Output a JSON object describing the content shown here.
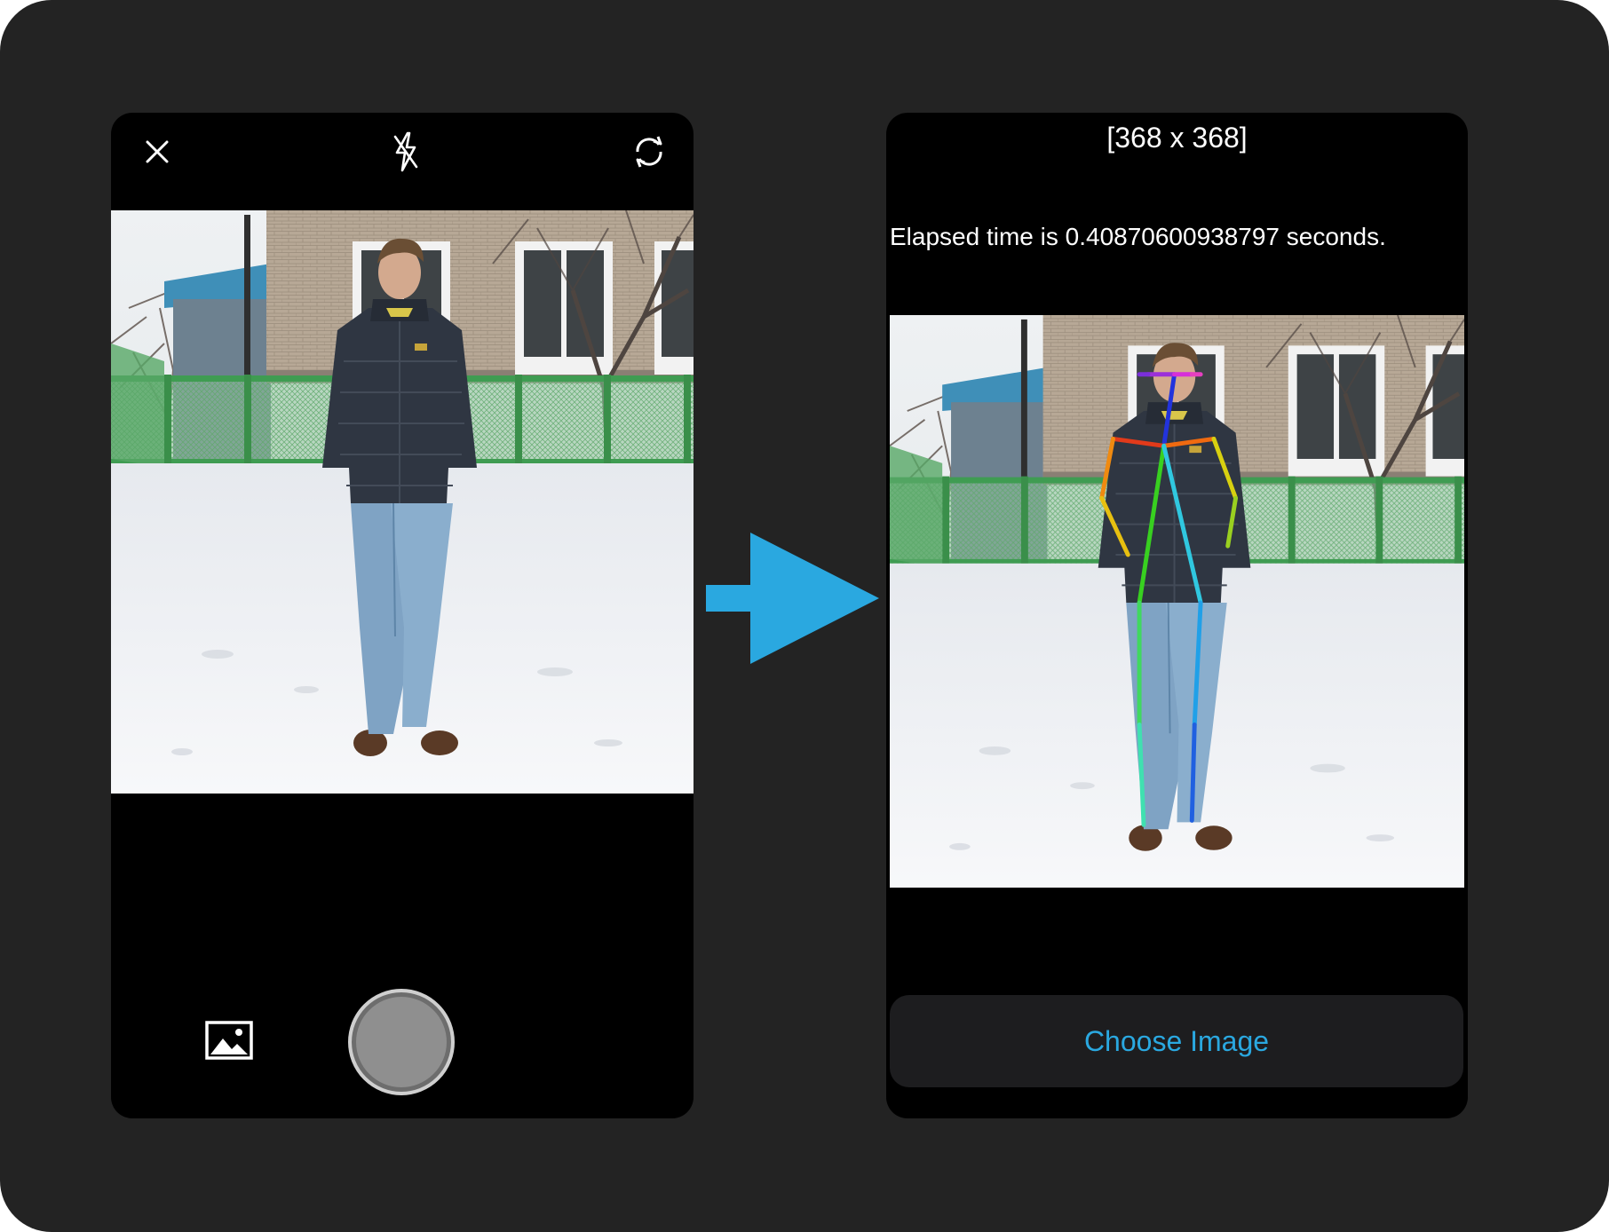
{
  "left_screen": {
    "icons": {
      "close": "close-icon",
      "flash": "flash-off-icon",
      "switch": "switch-camera-icon",
      "gallery": "gallery-icon",
      "shutter": "shutter-button"
    }
  },
  "right_screen": {
    "dimensions_label": "[368 x 368]",
    "elapsed_text": "Elapsed time is 0.40870600938797 seconds.",
    "choose_button_label": "Choose Image"
  },
  "arrow": {
    "color": "#2aa8e0",
    "icon": "right-arrow-icon"
  },
  "colors": {
    "frame_bg": "#232323",
    "screen_bg": "#000000",
    "accent": "#2aa8e0",
    "button_bg": "#1d1d1f"
  }
}
